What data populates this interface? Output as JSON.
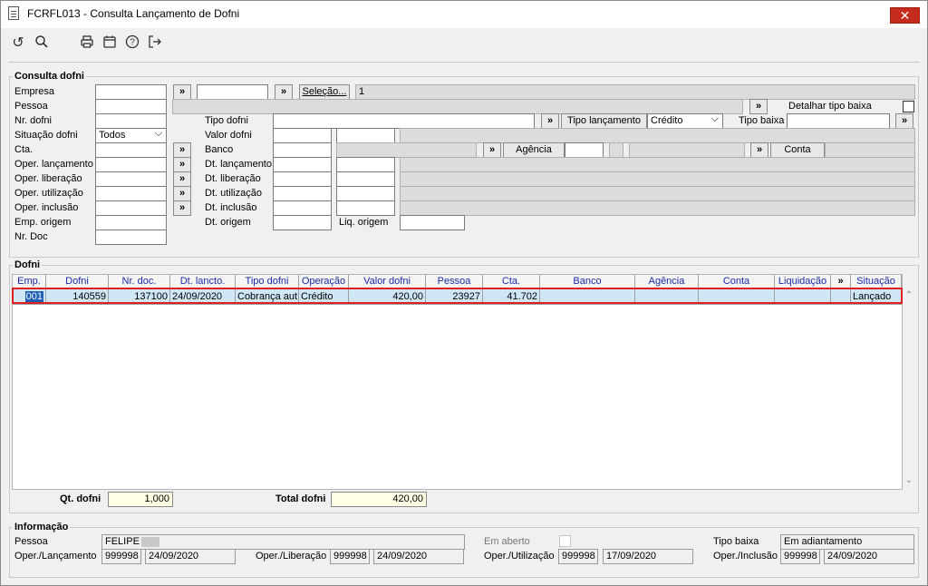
{
  "window": {
    "title": "FCRFL013 - Consulta Lançamento de Dofni",
    "close_label": "✕"
  },
  "toolbar": {
    "icons": [
      "undo-icon",
      "search-icon",
      "print-icon",
      "calendar-icon",
      "help-icon",
      "exit-icon"
    ]
  },
  "consulta": {
    "title": "Consulta dofni",
    "empresa_label": "Empresa",
    "selecao_label": "Seleção...",
    "selecao_value": "1",
    "pessoa_label": "Pessoa",
    "detalhar_label": "Detalhar tipo baixa",
    "nr_dofni_label": "Nr. dofni",
    "tipo_dofni_label": "Tipo dofni",
    "tipo_lancamento_label": "Tipo lançamento",
    "tipo_lancamento_value": "Crédito",
    "tipo_baixa_label": "Tipo baixa",
    "situacao_label": "Situação dofni",
    "situacao_value": "Todos",
    "valor_dofni_label": "Valor dofni",
    "cta_label": "Cta.",
    "banco_label": "Banco",
    "agencia_label": "Agência",
    "conta_label": "Conta",
    "oper_lanc_label": "Oper. lançamento",
    "dt_lanc_label": "Dt. lançamento",
    "oper_lib_label": "Oper. liberação",
    "dt_lib_label": "Dt. liberação",
    "oper_util_label": "Oper. utilização",
    "dt_util_label": "Dt. utilização",
    "oper_incl_label": "Oper. inclusão",
    "dt_incl_label": "Dt. inclusão",
    "emp_origem_label": "Emp. origem",
    "dt_origem_label": "Dt. origem",
    "liq_origem_label": "Liq. origem",
    "nr_doc_label": "Nr. Doc",
    "more_label": "»"
  },
  "dofni": {
    "title": "Dofni",
    "columns": [
      "Emp.",
      "Dofni",
      "Nr. doc.",
      "Dt. lancto.",
      "Tipo dofni",
      "Operação",
      "Valor dofni",
      "Pessoa",
      "Cta.",
      "Banco",
      "Agência",
      "Conta",
      "Liquidação",
      "»",
      "Situação"
    ],
    "row": [
      "001",
      "140559",
      "137100",
      "24/09/2020",
      "Cobrança aut",
      "Crédito",
      "420,00",
      "23927",
      "41.702",
      "",
      "",
      "",
      "",
      "",
      "Lançado"
    ],
    "qt_label": "Qt. dofni",
    "qt_value": "1,000",
    "total_label": "Total dofni",
    "total_value": "420,00"
  },
  "info": {
    "title": "Informação",
    "pessoa_label": "Pessoa",
    "pessoa_value": "FELIPE",
    "em_aberto_label": "Em aberto",
    "tipo_baixa_label": "Tipo baixa",
    "tipo_baixa_value": "Em adiantamento",
    "oper_lanc_label": "Oper./Lançamento",
    "oper_lanc_code": "999998",
    "oper_lanc_date": "24/09/2020",
    "oper_lib_label": "Oper./Liberação",
    "oper_lib_code": "999998",
    "oper_lib_date": "24/09/2020",
    "oper_util_label": "Oper./Utilização",
    "oper_util_code": "999998",
    "oper_util_date": "17/09/2020",
    "oper_incl_label": "Oper./Inclusão",
    "oper_incl_code": "999998",
    "oper_incl_date": "24/09/2020"
  }
}
